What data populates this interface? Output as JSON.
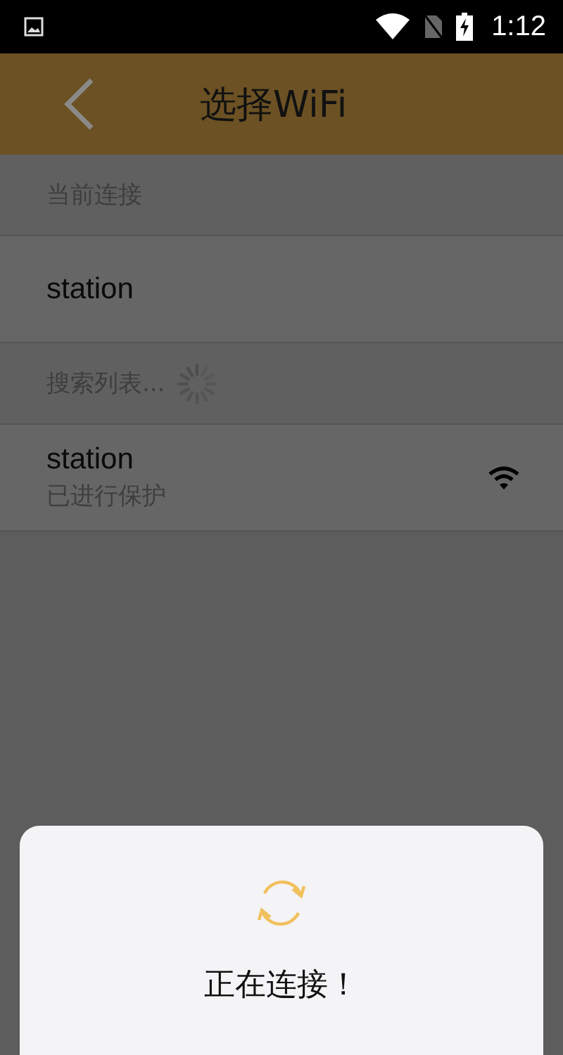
{
  "status_bar": {
    "time": "1:12"
  },
  "header": {
    "title": "选择WiFi"
  },
  "current_section": {
    "label": "当前连接",
    "network": {
      "name": "station"
    }
  },
  "search_section": {
    "label": "搜索列表...",
    "loading": true,
    "networks": [
      {
        "name": "station",
        "security": "已进行保护"
      }
    ]
  },
  "dialog": {
    "message": "正在连接！"
  }
}
